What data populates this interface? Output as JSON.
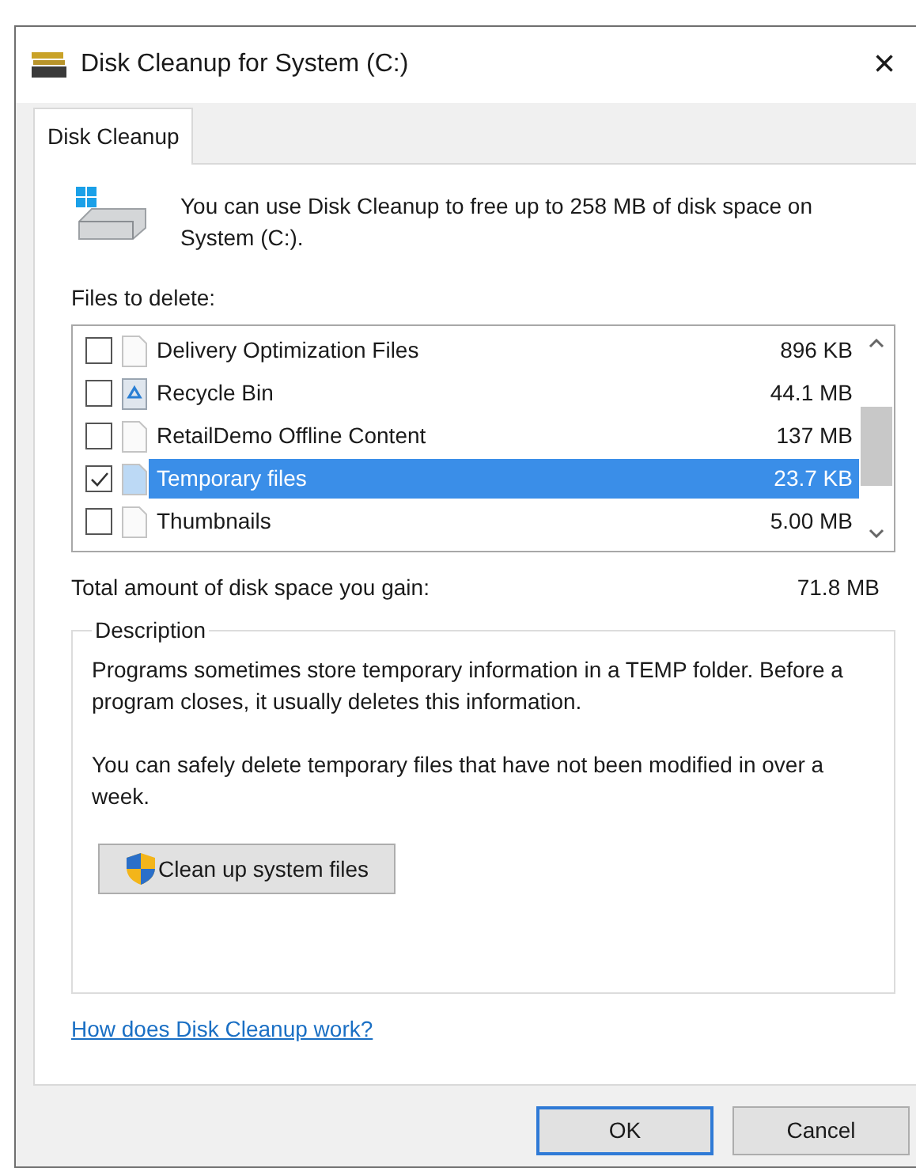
{
  "window": {
    "title": "Disk Cleanup for System (C:)",
    "close": "×"
  },
  "tabs": [
    {
      "label": "Disk Cleanup",
      "selected": true
    }
  ],
  "summary": "You can use Disk Cleanup to free up to 258 MB of disk space on System (C:).",
  "files_label": "Files to delete:",
  "files": [
    {
      "name": "Delivery Optimization Files",
      "size": "896 KB",
      "checked": false,
      "selected": false,
      "kind": "document"
    },
    {
      "name": "Recycle Bin",
      "size": "44.1 MB",
      "checked": false,
      "selected": false,
      "kind": "recycle"
    },
    {
      "name": "RetailDemo Offline Content",
      "size": "137 MB",
      "checked": false,
      "selected": false,
      "kind": "document"
    },
    {
      "name": "Temporary files",
      "size": "23.7 KB",
      "checked": true,
      "selected": true,
      "kind": "document"
    },
    {
      "name": "Thumbnails",
      "size": "5.00 MB",
      "checked": false,
      "selected": false,
      "kind": "document"
    }
  ],
  "total": {
    "label": "Total amount of disk space you gain:",
    "value": "71.8 MB"
  },
  "description": {
    "title": "Description",
    "paragraphs": [
      "Programs sometimes store temporary information in a TEMP folder. Before a program closes, it usually deletes this information.",
      "You can safely delete temporary files that have not been modified in over a week."
    ]
  },
  "cleanup_button": "Clean up system files",
  "help_link": "How does Disk Cleanup work?",
  "buttons": [
    {
      "label": "OK",
      "default": true
    },
    {
      "label": "Cancel",
      "default": false
    }
  ]
}
